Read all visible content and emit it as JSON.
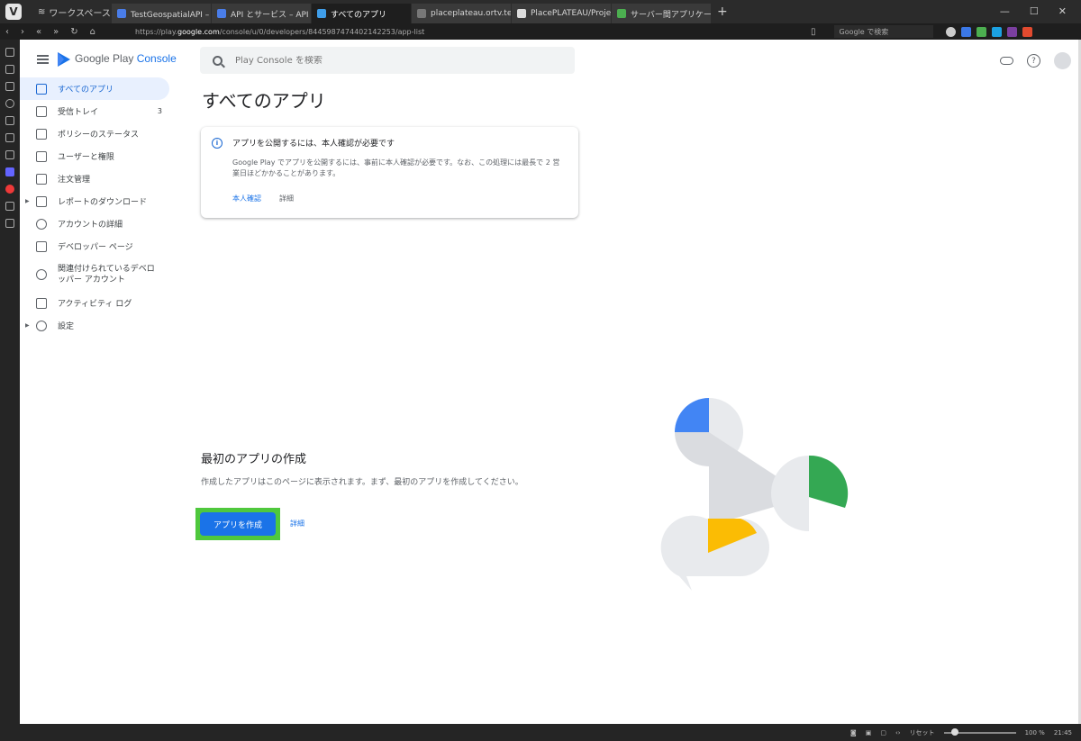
{
  "browser": {
    "workspace": "ワークスペース",
    "tabs": [
      {
        "title": "TestGeospatialAPI – IAM と管理",
        "color": "#4a7de8"
      },
      {
        "title": "API とサービス – API とサービス",
        "color": "#4a7de8"
      },
      {
        "title": "すべてのアプリ",
        "color": "#3f9de8",
        "active": true
      },
      {
        "title": "placeplateau.ortv.tech/token",
        "color": "#777777"
      },
      {
        "title": "PlacePLATEAU/ProjectSettings",
        "color": "#dddddd"
      },
      {
        "title": "サーバー間アプリケーションに OAuth",
        "color": "#4caf50"
      }
    ],
    "url_prefix": "https://play.",
    "url_domain": "google.com",
    "url_path": "/console/u/0/developers/8445987474402142253/app-list",
    "search_placeholder": "Google で検索",
    "zoom_label": "リセット",
    "zoom": "100 %",
    "clock": "21:45"
  },
  "brand": {
    "google": "Google Play",
    "console": "Console"
  },
  "sidebar": {
    "items": [
      {
        "label": "すべてのアプリ"
      },
      {
        "label": "受信トレイ",
        "badge": "3"
      },
      {
        "label": "ポリシーのステータス"
      },
      {
        "label": "ユーザーと権限"
      },
      {
        "label": "注文管理"
      },
      {
        "label": "レポートのダウンロード"
      },
      {
        "label": "アカウントの詳細"
      },
      {
        "label": "デベロッパー ページ"
      },
      {
        "label": "関連付けられているデベロッパー アカウント"
      },
      {
        "label": "アクティビティ ログ"
      },
      {
        "label": "設定"
      }
    ]
  },
  "search": {
    "placeholder": "Play Console を検索"
  },
  "main": {
    "title": "すべてのアプリ",
    "notice": {
      "title": "アプリを公開するには、本人確認が必要です",
      "body": "Google Play でアプリを公開するには、事前に本人確認が必要です。なお、この処理には最長で 2 営業日ほどかかることがあります。",
      "primary": "本人確認",
      "secondary": "詳細"
    },
    "empty": {
      "title": "最初のアプリの作成",
      "desc": "作成したアプリはこのページに表示されます。まず、最初のアプリを作成してください。",
      "create": "アプリを作成",
      "more": "詳細"
    }
  },
  "colors": {
    "accent": "#1a73e8",
    "highlight": "#4fc83d",
    "illus_blue": "#4285f4",
    "illus_green": "#34a853",
    "illus_yellow": "#fbbc04"
  }
}
